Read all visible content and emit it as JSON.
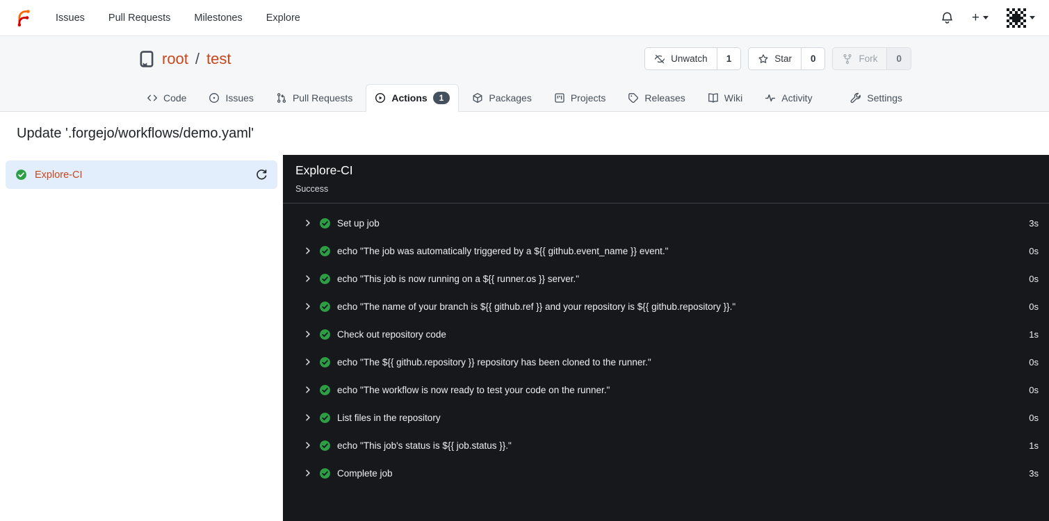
{
  "colors": {
    "accent": "#c8461b",
    "success_green": "#2c9f45",
    "panel_bg": "#17181c",
    "selected_job_bg": "#e2eefb",
    "badge_bg": "#45505f",
    "logo_orange": "#ff6600",
    "logo_red": "#d40000"
  },
  "navbar": {
    "links": [
      "Issues",
      "Pull Requests",
      "Milestones",
      "Explore"
    ],
    "create_label": "+"
  },
  "repo": {
    "owner": "root",
    "separator": "/",
    "name": "test",
    "actions": [
      {
        "name": "unwatch",
        "icon": "eye-off-icon",
        "label": "Unwatch",
        "count": "1",
        "disabled": false
      },
      {
        "name": "star",
        "icon": "star-icon",
        "label": "Star",
        "count": "0",
        "disabled": false
      },
      {
        "name": "fork",
        "icon": "fork-icon",
        "label": "Fork",
        "count": "0",
        "disabled": true
      }
    ],
    "tabs": [
      {
        "name": "code",
        "icon": "code-icon",
        "label": "Code"
      },
      {
        "name": "issues",
        "icon": "issue-icon",
        "label": "Issues"
      },
      {
        "name": "pull-requests",
        "icon": "pull-request-icon",
        "label": "Pull Requests"
      },
      {
        "name": "actions",
        "icon": "play-circle-icon",
        "label": "Actions",
        "badge": "1",
        "active": true
      },
      {
        "name": "packages",
        "icon": "package-icon",
        "label": "Packages"
      },
      {
        "name": "projects",
        "icon": "project-icon",
        "label": "Projects"
      },
      {
        "name": "releases",
        "icon": "tag-icon",
        "label": "Releases"
      },
      {
        "name": "wiki",
        "icon": "book-icon",
        "label": "Wiki"
      },
      {
        "name": "activity",
        "icon": "pulse-icon",
        "label": "Activity"
      },
      {
        "name": "settings",
        "icon": "tools-icon",
        "label": "Settings",
        "right": true
      }
    ]
  },
  "run": {
    "title": "Update '.forgejo/workflows/demo.yaml'",
    "job_name": "Explore-CI",
    "panel_title": "Explore-CI",
    "status": "Success",
    "steps": [
      {
        "name": "Set up job",
        "duration": "3s"
      },
      {
        "name": "echo \"The job was automatically triggered by a ${{ github.event_name }} event.\"",
        "duration": "0s"
      },
      {
        "name": "echo \"This job is now running on a ${{ runner.os }} server.\"",
        "duration": "0s"
      },
      {
        "name": "echo \"The name of your branch is ${{ github.ref }} and your repository is ${{ github.repository }}.\"",
        "duration": "0s"
      },
      {
        "name": "Check out repository code",
        "duration": "1s"
      },
      {
        "name": "echo \"The ${{ github.repository }} repository has been cloned to the runner.\"",
        "duration": "0s"
      },
      {
        "name": "echo \"The workflow is now ready to test your code on the runner.\"",
        "duration": "0s"
      },
      {
        "name": "List files in the repository",
        "duration": "0s"
      },
      {
        "name": "echo \"This job's status is ${{ job.status }}.\"",
        "duration": "1s"
      },
      {
        "name": "Complete job",
        "duration": "3s"
      }
    ]
  }
}
